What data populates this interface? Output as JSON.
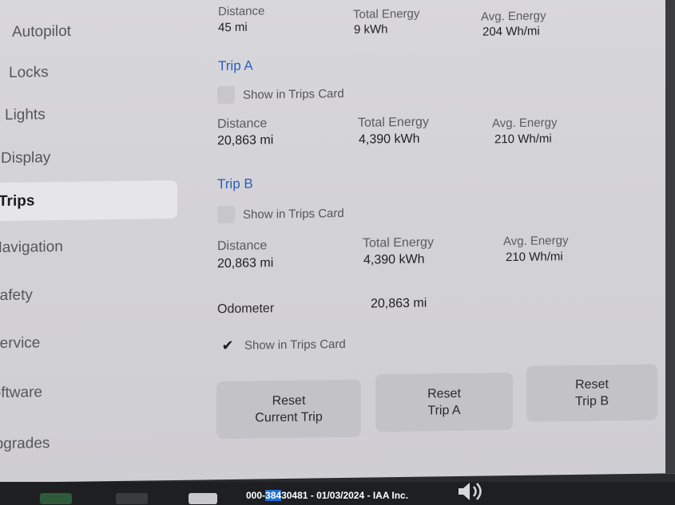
{
  "sidebar": {
    "items": [
      {
        "label": "Autopilot"
      },
      {
        "label": "Locks"
      },
      {
        "label": "Lights"
      },
      {
        "label": "Display"
      },
      {
        "label": "Trips"
      },
      {
        "label": "Navigation"
      },
      {
        "label": "Safety"
      },
      {
        "label": "Service"
      },
      {
        "label": "Software"
      },
      {
        "label": "Upgrades"
      }
    ],
    "active": "Trips"
  },
  "current_trip": {
    "distance_label": "Distance",
    "distance_value": "45 mi",
    "energy_label": "Total Energy",
    "energy_value": "9 kWh",
    "avg_label": "Avg. Energy",
    "avg_value": "204 Wh/mi"
  },
  "trip_a": {
    "title": "Trip A",
    "show_label": "Show in Trips Card",
    "show_checked": false,
    "distance_label": "Distance",
    "distance_value": "20,863 mi",
    "energy_label": "Total Energy",
    "energy_value": "4,390 kWh",
    "avg_label": "Avg. Energy",
    "avg_value": "210 Wh/mi"
  },
  "trip_b": {
    "title": "Trip B",
    "show_label": "Show in Trips Card",
    "show_checked": false,
    "distance_label": "Distance",
    "distance_value": "20,863 mi",
    "energy_label": "Total Energy",
    "energy_value": "4,390 kWh",
    "avg_label": "Avg. Energy",
    "avg_value": "210 Wh/mi"
  },
  "odometer": {
    "label": "Odometer",
    "value": "20,863 mi",
    "show_label": "Show in Trips Card",
    "show_checked": true,
    "check_glyph": "✔"
  },
  "buttons": {
    "reset_current_line1": "Reset",
    "reset_current_line2": "Current Trip",
    "reset_a_line1": "Reset",
    "reset_a_line2": "Trip A",
    "reset_b_line1": "Reset",
    "reset_b_line2": "Trip B"
  },
  "watermark": {
    "prefix": "000-",
    "highlight": "384",
    "rest": "30481 - 01/03/2024 - IAA Inc."
  }
}
